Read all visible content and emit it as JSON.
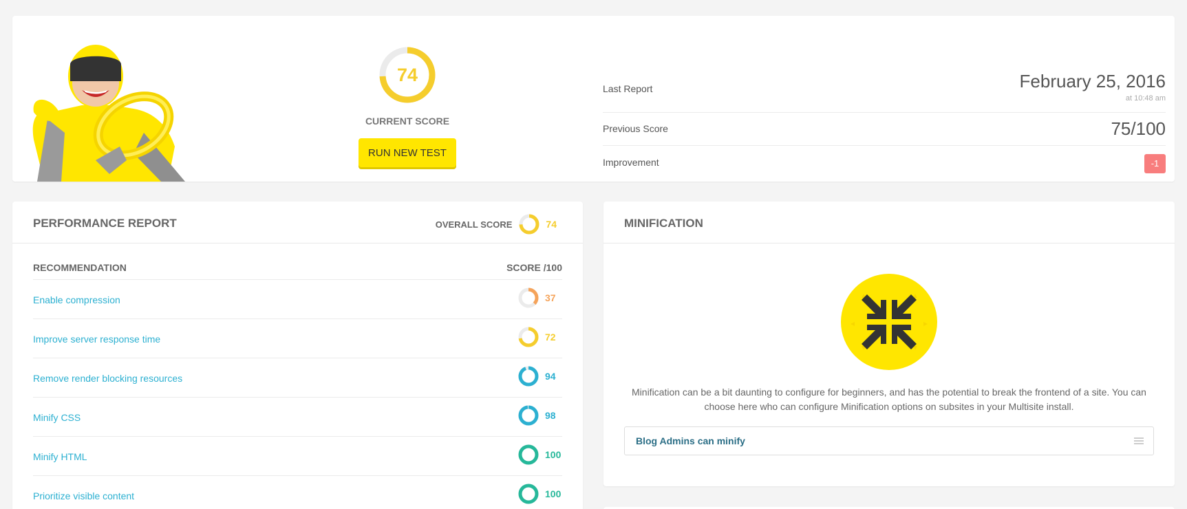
{
  "summary": {
    "score_value": "74",
    "score_fraction": 0.74,
    "score_color": "#f5cd2d",
    "current_score_label": "CURRENT SCORE",
    "run_button_label": "RUN NEW TEST",
    "last_report_label": "Last Report",
    "last_report_date": "February 25, 2016",
    "last_report_time": "at 10:48 am",
    "previous_score_label": "Previous Score",
    "previous_score_value": "75/100",
    "improvement_label": "Improvement",
    "improvement_value": "-1",
    "improvement_color": "#f87d7d"
  },
  "performance": {
    "title": "PERFORMANCE REPORT",
    "overall_label": "OVERALL SCORE",
    "overall_value": "74",
    "overall_fraction": 0.74,
    "col_recommendation": "RECOMMENDATION",
    "col_score": "SCORE /100",
    "rows": [
      {
        "name": "Enable compression",
        "score": "37",
        "fraction": 0.37,
        "color": "#f5a35a"
      },
      {
        "name": "Improve server response time",
        "score": "72",
        "fraction": 0.72,
        "color": "#f5cd2d"
      },
      {
        "name": "Remove render blocking resources",
        "score": "94",
        "fraction": 0.94,
        "color": "#2cb0d1"
      },
      {
        "name": "Minify CSS",
        "score": "98",
        "fraction": 0.98,
        "color": "#2cb0d1"
      },
      {
        "name": "Minify HTML",
        "score": "100",
        "fraction": 1.0,
        "color": "#26b89a"
      },
      {
        "name": "Prioritize visible content",
        "score": "100",
        "fraction": 1.0,
        "color": "#26b89a"
      }
    ]
  },
  "minification": {
    "title": "MINIFICATION",
    "icon": "minify-arrows-icon",
    "description": "Minification can be a bit daunting to configure for beginners, and has the potential to break the frontend of a site. You can choose here who can configure Minification options on subsites in your Multisite install.",
    "select_value": "Blog Admins can minify"
  },
  "colors": {
    "accent_yellow": "#ffe600",
    "link_blue": "#2cb0d1"
  }
}
